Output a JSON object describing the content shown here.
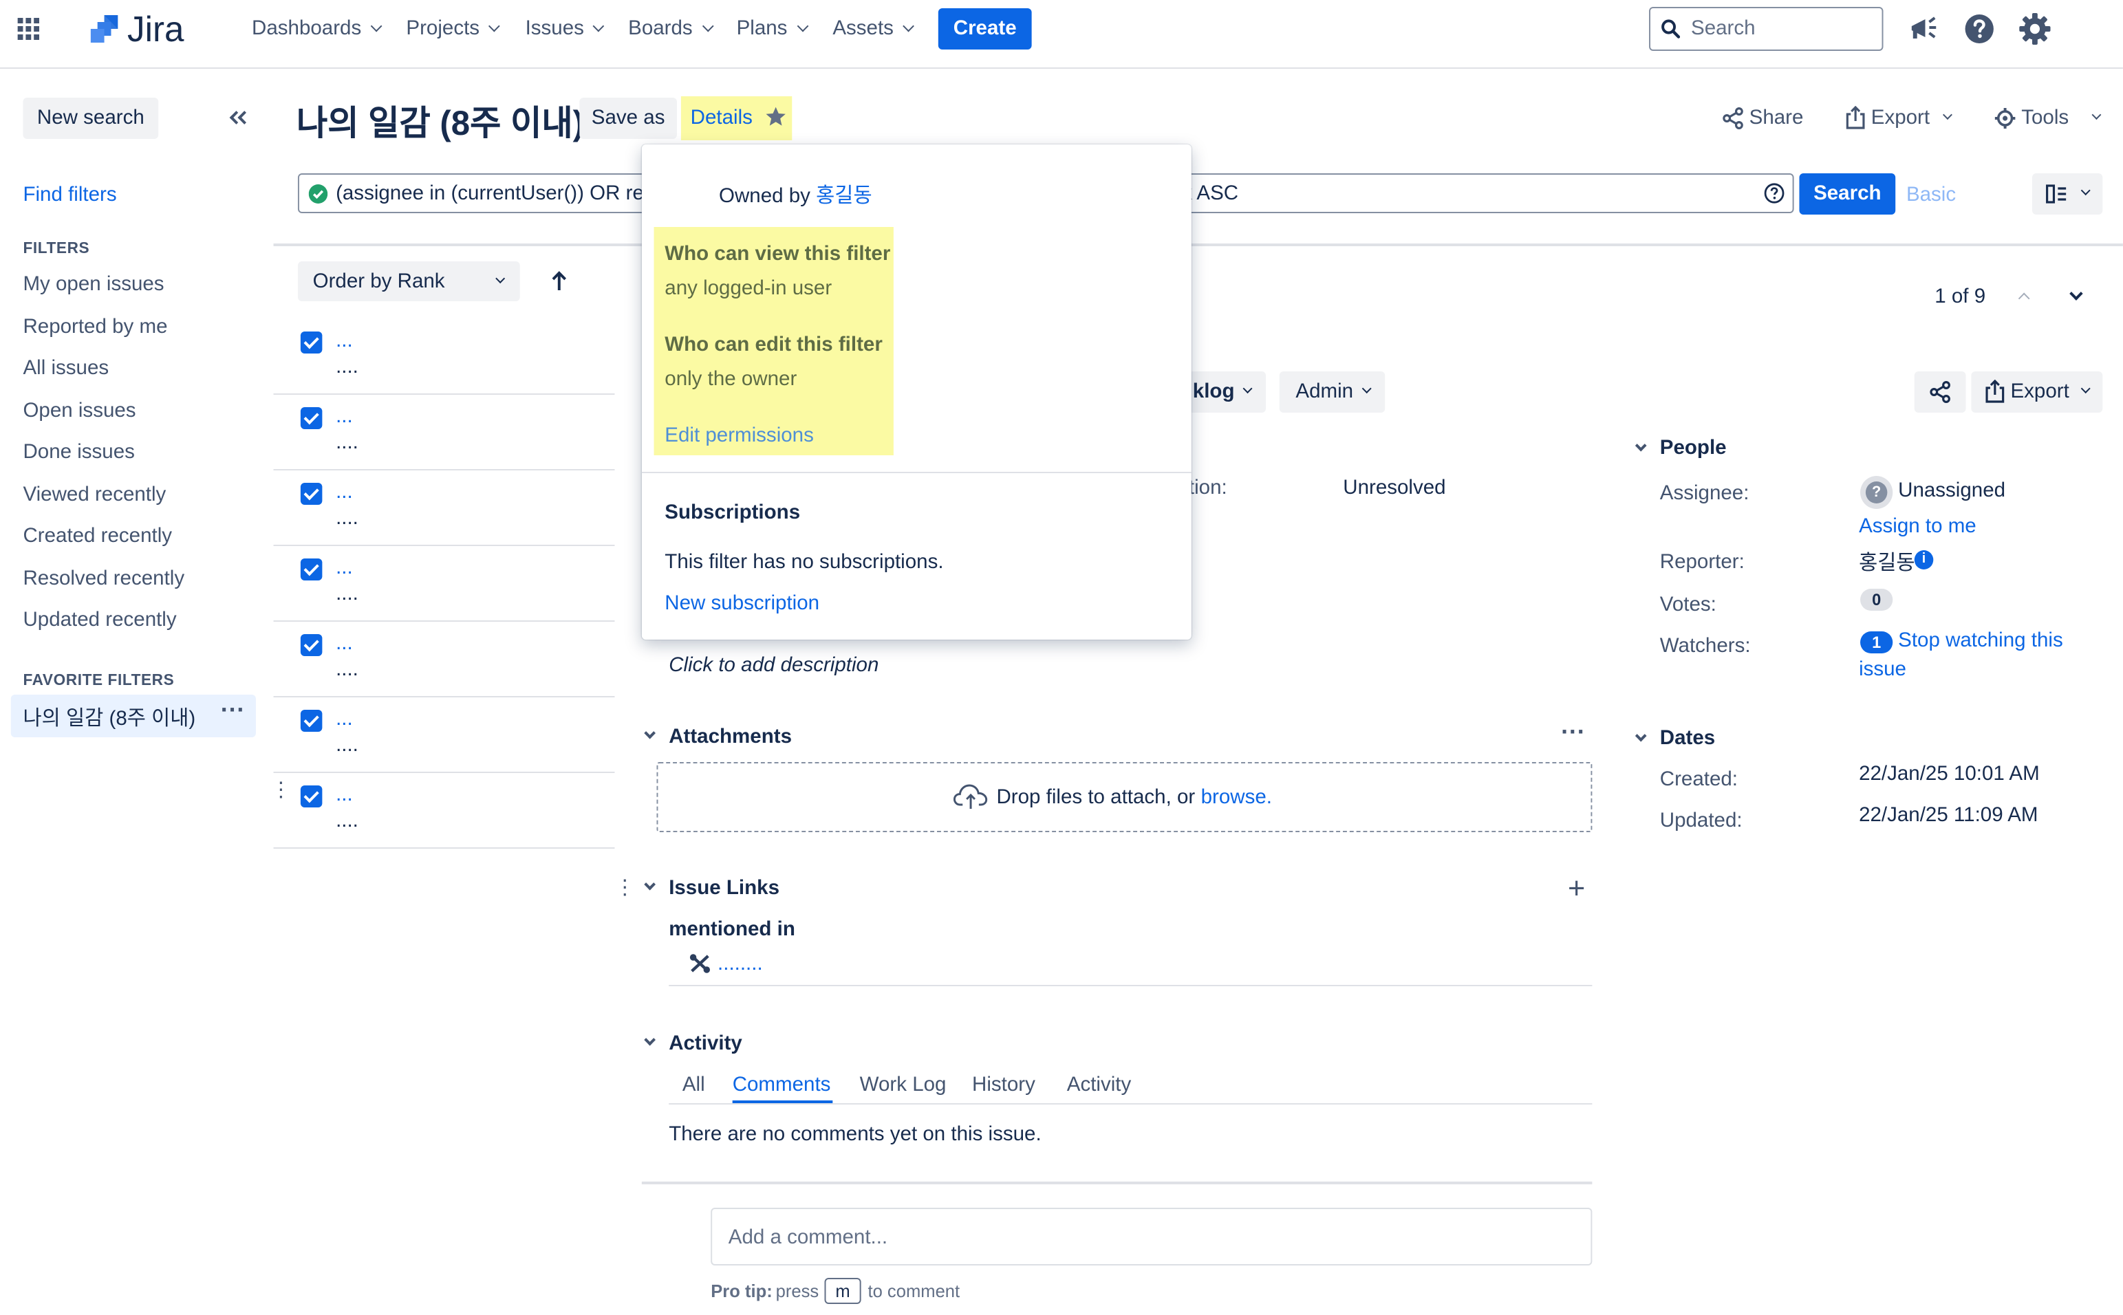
{
  "nav": {
    "logo_text": "Jira",
    "items": [
      "Dashboards",
      "Projects",
      "Issues",
      "Boards",
      "Plans",
      "Assets"
    ],
    "create_label": "Create",
    "search_placeholder": "Search"
  },
  "sidebar": {
    "new_search": "New search",
    "find_filters": "Find filters",
    "filters_heading": "FILTERS",
    "filters": [
      "My open issues",
      "Reported by me",
      "All issues",
      "Open issues",
      "Done issues",
      "Viewed recently",
      "Created recently",
      "Resolved recently",
      "Updated recently"
    ],
    "favorite_heading": "FAVORITE FILTERS",
    "favorite_item": "나의 일감 (8주 이내)"
  },
  "header": {
    "title": "나의 일감 (8주 이내)",
    "save_as": "Save as",
    "details": "Details",
    "share": "Share",
    "export": "Export",
    "tools": "Tools"
  },
  "query": {
    "text_left": "(assignee in (currentUser()) OR rep",
    "text_right": "k ASC",
    "search_button": "Search",
    "basic": "Basic"
  },
  "list": {
    "order_by": "Order by Rank",
    "pagination": "1 of 9",
    "rows": [
      {
        "key": "...",
        "summary": "...."
      },
      {
        "key": "...",
        "summary": "...."
      },
      {
        "key": "...",
        "summary": "...."
      },
      {
        "key": "...",
        "summary": "...."
      },
      {
        "key": "...",
        "summary": "...."
      },
      {
        "key": "...",
        "summary": "...."
      },
      {
        "key": "...",
        "summary": "...."
      }
    ]
  },
  "popup": {
    "owned_by": "Owned by",
    "owner": "홍길동",
    "view_title": "Who can view this filter",
    "view_value": "any logged-in user",
    "edit_title": "Who can edit this filter",
    "edit_value": "only the owner",
    "edit_permissions": "Edit permissions",
    "subscriptions_title": "Subscriptions",
    "subscriptions_text": "This filter has no subscriptions.",
    "new_subscription": "New subscription"
  },
  "issue": {
    "workflow_btn_partial": "klog",
    "admin_btn": "Admin",
    "export": "Export",
    "resolution_label_partial": "tion:",
    "resolution_value": "Unresolved",
    "description_placeholder": "Click to add description",
    "attachments_title": "Attachments",
    "drop_text": "Drop files to attach, or",
    "browse": "browse.",
    "issue_links_title": "Issue Links",
    "mentioned_in": "mentioned in",
    "linked_issue": "........",
    "activity_title": "Activity",
    "tabs": [
      "All",
      "Comments",
      "Work Log",
      "History",
      "Activity"
    ],
    "active_tab": "Comments",
    "no_comments": "There are no comments yet on this issue.",
    "comment_placeholder": "Add a comment...",
    "pro_tip_label": "Pro tip:",
    "pro_tip_press": "press",
    "pro_tip_key": "m",
    "pro_tip_rest": "to comment"
  },
  "people": {
    "title": "People",
    "assignee_label": "Assignee:",
    "assignee_value": "Unassigned",
    "assign_to_me": "Assign to me",
    "reporter_label": "Reporter:",
    "reporter_value": "홍길동",
    "votes_label": "Votes:",
    "votes_value": "0",
    "watchers_label": "Watchers:",
    "watchers_count": "1",
    "stop_watching_line1": "Stop watching this",
    "stop_watching_line2": "issue"
  },
  "dates": {
    "title": "Dates",
    "created_label": "Created:",
    "created_value": "22/Jan/25 10:01 AM",
    "updated_label": "Updated:",
    "updated_value": "22/Jan/25 11:09 AM"
  },
  "colors": {
    "brand": "#0c66e4",
    "highlight": "#fbfaa3",
    "text": "#172b4d",
    "subtle": "#44546f"
  }
}
